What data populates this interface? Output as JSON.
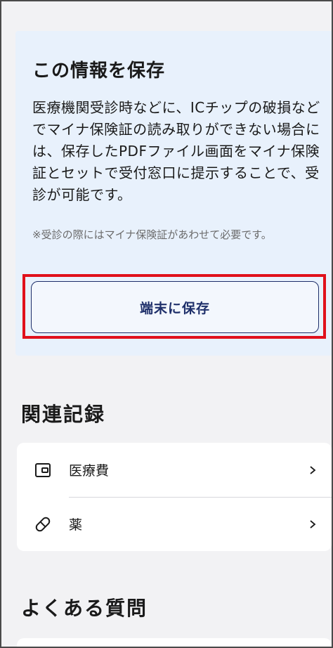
{
  "save_section": {
    "title": "この情報を保存",
    "body": "医療機関受診時などに、ICチップの破損などでマイナ保険証の読み取りができない場合には、保存したPDFファイル画面をマイナ保険証とセットで受付窓口に提示することで、受診が可能です。",
    "note": "※受診の際にはマイナ保険証があわせて必要です。",
    "save_button_label": "端末に保存"
  },
  "related_records": {
    "heading": "関連記録",
    "items": [
      {
        "label": "医療費",
        "icon": "wallet-icon"
      },
      {
        "label": "薬",
        "icon": "pill-icon"
      }
    ]
  },
  "faq": {
    "heading": "よくある質問"
  },
  "colors": {
    "card_bg": "#e8f1fc",
    "button_text": "#1e2f6a",
    "highlight": "#e0101b",
    "page_bg": "#f2f2f4"
  }
}
